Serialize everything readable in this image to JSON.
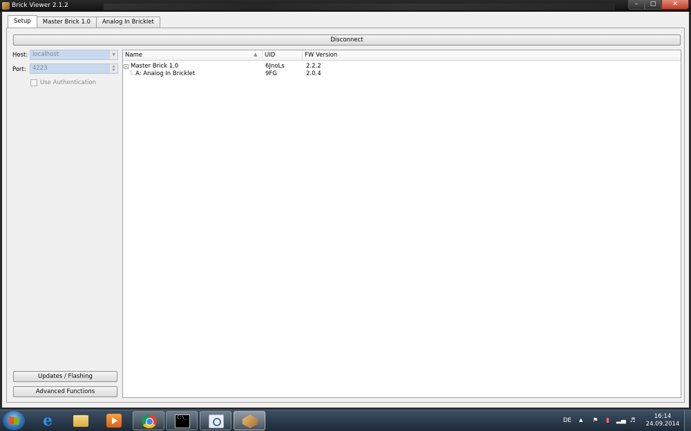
{
  "window": {
    "title": "Brick Viewer 2.1.2"
  },
  "tabs": [
    {
      "label": "Setup",
      "active": true
    },
    {
      "label": "Master Brick 1.0",
      "active": false
    },
    {
      "label": "Analog In Bricklet",
      "active": false
    }
  ],
  "setup": {
    "disconnect_label": "Disconnect",
    "host_label": "Host:",
    "host_value": "localhost",
    "port_label": "Port:",
    "port_value": "4223",
    "use_auth_label": "Use Authentication",
    "updates_label": "Updates / Flashing",
    "advanced_label": "Advanced Functions"
  },
  "tree": {
    "columns": [
      "Name",
      "UID",
      "FW Version"
    ],
    "rows": [
      {
        "name": "Master Brick 1.0",
        "uid": "6JnoLs",
        "fw": "2.2.2"
      },
      {
        "name": "A: Analog In Bricklet",
        "uid": "9FG",
        "fw": "2.0.4"
      }
    ]
  },
  "taskbar": {
    "language": "DE",
    "time": "16:14",
    "date": "24.09.2014",
    "cmd_icon_text": "C:\\_"
  },
  "colors": {
    "accent": "#c8d9ee",
    "taskbar": "#1d2a38",
    "close_button": "#c23d25"
  }
}
